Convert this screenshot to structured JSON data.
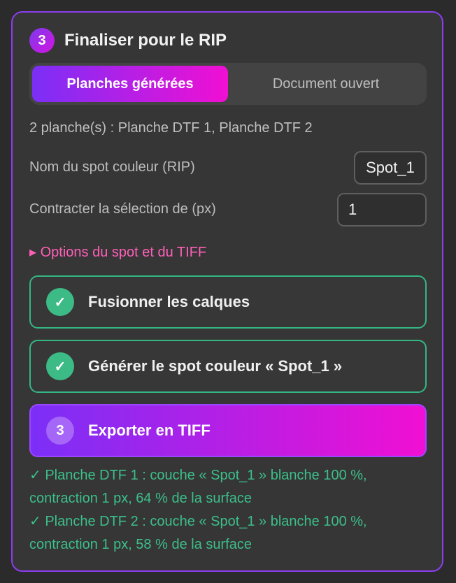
{
  "panel": {
    "step_number": "3",
    "title": "Finaliser pour le RIP"
  },
  "tabs": [
    {
      "label": "Planches générées",
      "active": true
    },
    {
      "label": "Document ouvert",
      "active": false
    }
  ],
  "summary": "2 planche(s) : Planche DTF 1, Planche DTF 2",
  "spot_name": {
    "label": "Nom du spot couleur (RIP)",
    "value": "Spot_1"
  },
  "contract": {
    "label": "Contracter la sélection de (px)",
    "value": "1"
  },
  "options_link": "▸ Options du spot et du TIFF",
  "steps": [
    {
      "icon": "✓",
      "label": "Fusionner les calques",
      "state": "done"
    },
    {
      "icon": "✓",
      "label": "Générer le spot couleur « Spot_1 »",
      "state": "done"
    },
    {
      "icon": "3",
      "label": "Exporter en TIFF",
      "state": "current"
    }
  ],
  "results": [
    "✓ Planche DTF 1 : couche « Spot_1 » blanche 100 %, contraction 1 px, 64 % de la surface",
    "✓ Planche DTF 2 : couche « Spot_1 » blanche 100 %, contraction 1 px, 58 % de la surface"
  ],
  "colors": {
    "accent_gradient_start": "#7b2ff7",
    "accent_gradient_end": "#f10fd3",
    "success": "#3cbf8a",
    "link": "#ff5fb8"
  }
}
